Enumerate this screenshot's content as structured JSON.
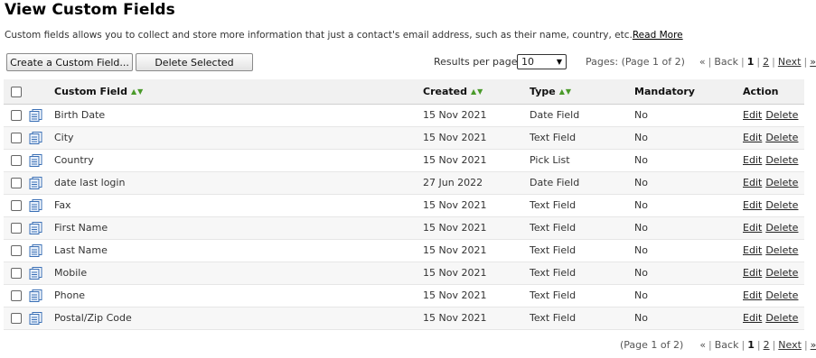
{
  "page": {
    "title": "View Custom Fields",
    "intro": "Custom fields allows you to collect and store more information that just a contact's email address, such as their name, country, etc.",
    "read_more": "Read More"
  },
  "toolbar": {
    "create_label": "Create a Custom Field...",
    "delete_label": "Delete Selected",
    "rpp_label": "Results per page:",
    "rpp_value": "10"
  },
  "pager_top": {
    "info": "Pages: (Page 1 of 2)",
    "first": "«",
    "back": "Back",
    "page1": "1",
    "page2": "2",
    "next": "Next",
    "last": "»"
  },
  "pager_bottom": {
    "info": "(Page 1 of 2)",
    "first": "«",
    "back": "Back",
    "page1": "1",
    "page2": "2",
    "next": "Next",
    "last": "»"
  },
  "table": {
    "headers": {
      "name": "Custom Field",
      "created": "Created",
      "type": "Type",
      "mandatory": "Mandatory",
      "action": "Action"
    },
    "edit_label": "Edit",
    "delete_label": "Delete",
    "rows": [
      {
        "name": "Birth Date",
        "created": "15 Nov 2021",
        "type": "Date Field",
        "mandatory": "No"
      },
      {
        "name": "City",
        "created": "15 Nov 2021",
        "type": "Text Field",
        "mandatory": "No"
      },
      {
        "name": "Country",
        "created": "15 Nov 2021",
        "type": "Pick List",
        "mandatory": "No"
      },
      {
        "name": "date last login",
        "created": "27 Jun 2022",
        "type": "Date Field",
        "mandatory": "No"
      },
      {
        "name": "Fax",
        "created": "15 Nov 2021",
        "type": "Text Field",
        "mandatory": "No"
      },
      {
        "name": "First Name",
        "created": "15 Nov 2021",
        "type": "Text Field",
        "mandatory": "No"
      },
      {
        "name": "Last Name",
        "created": "15 Nov 2021",
        "type": "Text Field",
        "mandatory": "No"
      },
      {
        "name": "Mobile",
        "created": "15 Nov 2021",
        "type": "Text Field",
        "mandatory": "No"
      },
      {
        "name": "Phone",
        "created": "15 Nov 2021",
        "type": "Text Field",
        "mandatory": "No"
      },
      {
        "name": "Postal/Zip Code",
        "created": "15 Nov 2021",
        "type": "Text Field",
        "mandatory": "No"
      }
    ]
  },
  "colors": {
    "sort_arrow": "#4a9a2a",
    "icon_blue": "#3a6fb5",
    "header_bg": "#f1f1f1"
  },
  "icons": {
    "row_icon": "document-icon",
    "sort_icon": "sort-arrows-icon",
    "select_icon": "chevron-down-icon"
  }
}
